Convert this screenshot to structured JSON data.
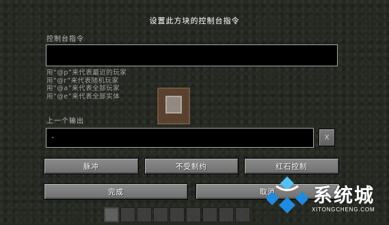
{
  "dialog": {
    "title": "设置此方块的控制台指令",
    "command_label": "控制台指令",
    "command_value": "",
    "hints": [
      "用“@p”来代表最近的玩家",
      "用“@r”来代表随机玩家",
      "用“@a”来代表全部玩家",
      "用“@e”来代表全部实体"
    ],
    "previous_output_label": "上一个输出",
    "previous_output_value": "-",
    "clear_output_label": "X",
    "mode_buttons": [
      "脉冲",
      "不受制约",
      "红石控制"
    ],
    "done_label": "完成",
    "cancel_label": "取消"
  },
  "watermark": {
    "brand": "系统城",
    "url": "XITONGCHENG.COM",
    "colors": {
      "blue": "#1e8be0",
      "light_blue": "#4fc3f7"
    }
  },
  "hotbar": {
    "slot_count": 9
  }
}
